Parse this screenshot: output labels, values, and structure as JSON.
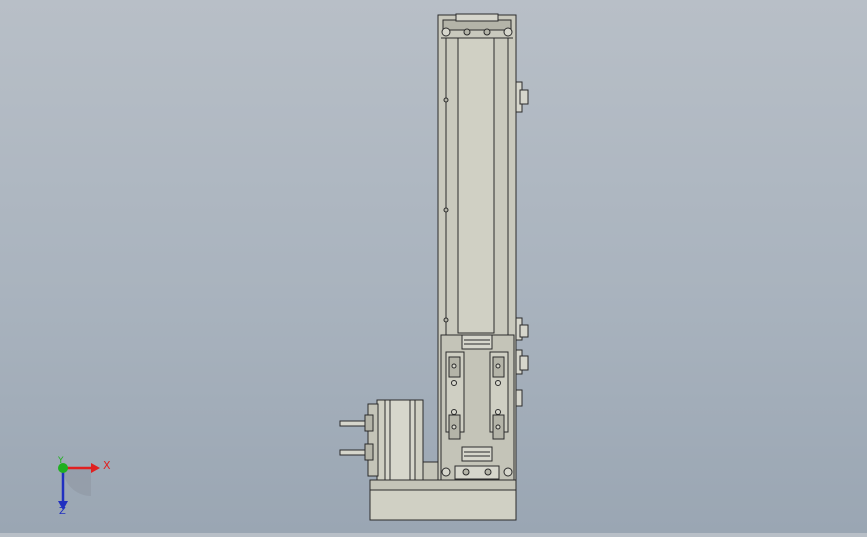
{
  "viewport": {
    "background_top": "#b8bfc7",
    "background_bottom": "#9aa6b3"
  },
  "model": {
    "line_color": "#2b2b2b",
    "fill_body": "#c9c9bd",
    "fill_dark": "#b4b4a8",
    "fill_light": "#d6d6cc"
  },
  "triad": {
    "x_label": "X",
    "y_label": "Y",
    "z_label": "Z",
    "x_color": "#e02020",
    "y_color": "#20b020",
    "z_color": "#2030c0"
  }
}
